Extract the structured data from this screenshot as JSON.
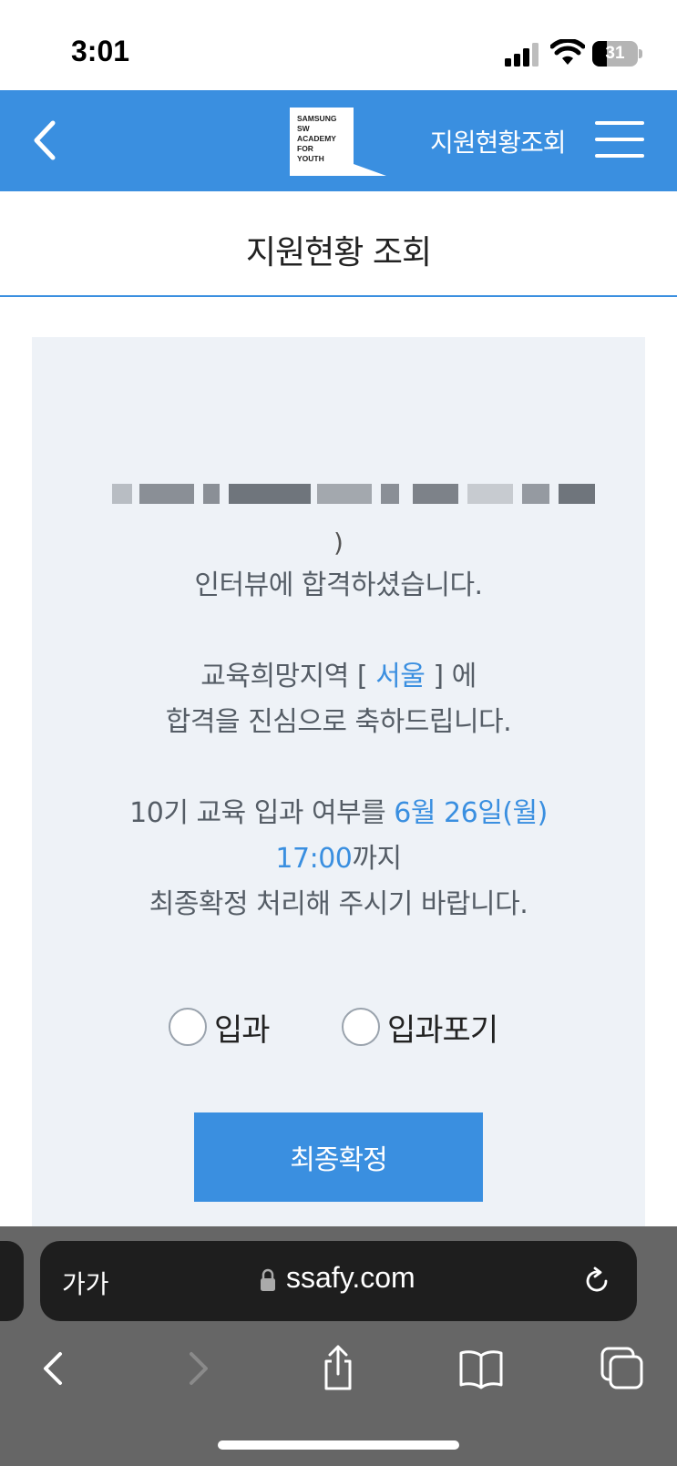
{
  "status_bar": {
    "time": "3:01",
    "battery": "31",
    "battery_level": 0.31,
    "icons": [
      "cellular-signal-icon",
      "wifi-icon",
      "battery-icon"
    ]
  },
  "header": {
    "back_icon": "chevron-left-icon",
    "logo_lines": [
      "SAMSUNG",
      "SW",
      "ACADEMY",
      "FOR",
      "YOUTH"
    ],
    "title": "지원현황조회",
    "menu_icon": "hamburger-menu-icon",
    "color": "#3a8fe0"
  },
  "page": {
    "title": "지원현황 조회"
  },
  "result": {
    "paren": ")",
    "line1": "인터뷰에 합격하셨습니다.",
    "region_prefix": "교육희망지역 [ ",
    "region": "서울",
    "region_suffix": " ] 에",
    "line3": "합격을 진심으로 축하드립니다.",
    "deadline_prefix": "10기 교육 입과 여부를 ",
    "deadline_date": "6월 26일(월)",
    "deadline_time": "17:00",
    "deadline_time_suffix": "까지",
    "line6": "최종확정 처리해 주시기 바랍니다."
  },
  "options": {
    "enroll": "입과",
    "decline": "입과포기",
    "selected": null
  },
  "confirm_button": "최종확정",
  "browser": {
    "text_size_label": "가가",
    "url": "ssafy.com",
    "icons": [
      "lock-icon",
      "reload-icon",
      "back-icon",
      "forward-icon",
      "share-icon",
      "bookmarks-icon",
      "tabs-icon"
    ]
  }
}
